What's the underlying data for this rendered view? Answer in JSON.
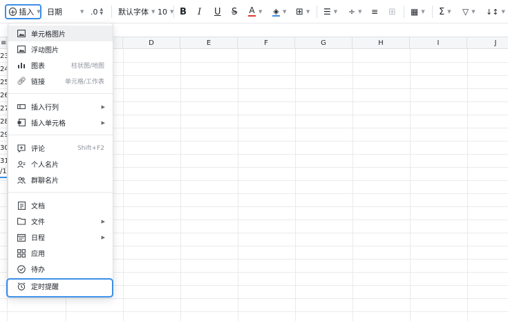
{
  "toolbar": {
    "insert_label": "插入",
    "number_format": "日期",
    "decimal": ".0",
    "font_family": "默认字体",
    "font_size": "10",
    "bold": "B",
    "italic": "I",
    "underline": "U",
    "strike": "S",
    "text_color": "A",
    "sum": "Σ",
    "colors": {
      "text_color_bar": "#d83931",
      "fill_color_bar": "#3b8ee8",
      "highlight": "#3b8ee8"
    }
  },
  "sheet": {
    "column_headers": [
      "D",
      "E",
      "F",
      "G",
      "H",
      "I",
      "J"
    ],
    "row_numbers": [
      "23",
      "24",
      "25",
      "26",
      "27",
      "28",
      "29",
      "30",
      "31",
      "/1"
    ]
  },
  "menu": {
    "items": [
      {
        "label": "单元格图片",
        "icon": "image-icon"
      },
      {
        "label": "浮动图片",
        "icon": "image-icon"
      },
      {
        "label": "图表",
        "hint": "柱状图/地图",
        "icon": "chart-icon"
      },
      {
        "label": "链接",
        "hint": "单元格/工作表",
        "icon": "link-icon"
      },
      {
        "label": "插入行列",
        "icon": "insert-row-col-icon",
        "submenu": true
      },
      {
        "label": "插入单元格",
        "icon": "insert-cell-icon",
        "submenu": true
      },
      {
        "label": "评论",
        "hint": "Shift+F2",
        "icon": "comment-icon"
      },
      {
        "label": "个人名片",
        "icon": "person-card-icon"
      },
      {
        "label": "群聊名片",
        "icon": "group-card-icon"
      },
      {
        "label": "文档",
        "icon": "doc-icon"
      },
      {
        "label": "文件",
        "icon": "folder-icon",
        "submenu": true
      },
      {
        "label": "日程",
        "icon": "calendar-icon",
        "submenu": true
      },
      {
        "label": "应用",
        "icon": "apps-icon"
      },
      {
        "label": "待办",
        "icon": "todo-icon"
      },
      {
        "label": "定时提醒",
        "icon": "alarm-icon"
      }
    ]
  }
}
